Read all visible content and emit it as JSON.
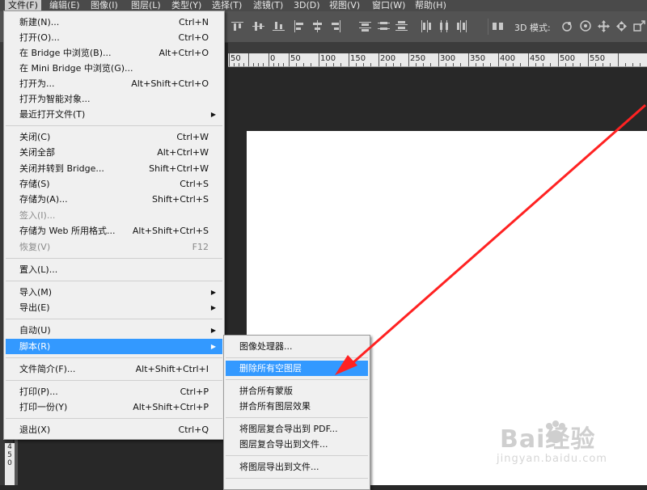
{
  "menubar": {
    "items": [
      {
        "label": "文件(F)"
      },
      {
        "label": "编辑(E)"
      },
      {
        "label": "图像(I)"
      },
      {
        "label": "图层(L)"
      },
      {
        "label": "类型(Y)"
      },
      {
        "label": "选择(T)"
      },
      {
        "label": "滤镜(T)"
      },
      {
        "label": "3D(D)"
      },
      {
        "label": "视图(V)"
      },
      {
        "label": "窗口(W)"
      },
      {
        "label": "帮助(H)"
      }
    ]
  },
  "optionsbar": {
    "mode_label": "3D 模式:"
  },
  "ruler": {
    "labels": [
      "50",
      "0",
      "50",
      "100",
      "150",
      "200",
      "250",
      "300",
      "350",
      "400",
      "450",
      "500",
      "550"
    ]
  },
  "side_ruler": {
    "digits": [
      "4",
      "5",
      "0"
    ]
  },
  "file_menu": {
    "items": [
      {
        "label": "新建(N)...",
        "shortcut": "Ctrl+N"
      },
      {
        "label": "打开(O)...",
        "shortcut": "Ctrl+O"
      },
      {
        "label": "在 Bridge 中浏览(B)...",
        "shortcut": "Alt+Ctrl+O"
      },
      {
        "label": "在 Mini Bridge 中浏览(G)...",
        "shortcut": ""
      },
      {
        "label": "打开为...",
        "shortcut": "Alt+Shift+Ctrl+O"
      },
      {
        "label": "打开为智能对象...",
        "shortcut": ""
      },
      {
        "label": "最近打开文件(T)",
        "shortcut": ""
      },
      {
        "label": "关闭(C)",
        "shortcut": "Ctrl+W"
      },
      {
        "label": "关闭全部",
        "shortcut": "Alt+Ctrl+W"
      },
      {
        "label": "关闭并转到 Bridge...",
        "shortcut": "Shift+Ctrl+W"
      },
      {
        "label": "存储(S)",
        "shortcut": "Ctrl+S"
      },
      {
        "label": "存储为(A)...",
        "shortcut": "Shift+Ctrl+S"
      },
      {
        "label": "签入(I)...",
        "shortcut": ""
      },
      {
        "label": "存储为 Web 所用格式...",
        "shortcut": "Alt+Shift+Ctrl+S"
      },
      {
        "label": "恢复(V)",
        "shortcut": "F12"
      },
      {
        "label": "置入(L)...",
        "shortcut": ""
      },
      {
        "label": "导入(M)",
        "shortcut": ""
      },
      {
        "label": "导出(E)",
        "shortcut": ""
      },
      {
        "label": "自动(U)",
        "shortcut": ""
      },
      {
        "label": "脚本(R)",
        "shortcut": ""
      },
      {
        "label": "文件简介(F)...",
        "shortcut": "Alt+Shift+Ctrl+I"
      },
      {
        "label": "打印(P)...",
        "shortcut": "Ctrl+P"
      },
      {
        "label": "打印一份(Y)",
        "shortcut": "Alt+Shift+Ctrl+P"
      },
      {
        "label": "退出(X)",
        "shortcut": "Ctrl+Q"
      }
    ]
  },
  "scripts_submenu": {
    "items": [
      {
        "label": "图像处理器..."
      },
      {
        "label": "删除所有空图层"
      },
      {
        "label": "拼合所有蒙版"
      },
      {
        "label": "拼合所有图层效果"
      },
      {
        "label": "将图层复合导出到 PDF..."
      },
      {
        "label": "图层复合导出到文件..."
      },
      {
        "label": "将图层导出到文件..."
      }
    ]
  },
  "watermark": {
    "logo_text": "Bai经验",
    "sub_text": "jingyan.baidu.com"
  },
  "colors": {
    "highlight": "#3399ff",
    "annotation_arrow": "#ff2222"
  }
}
